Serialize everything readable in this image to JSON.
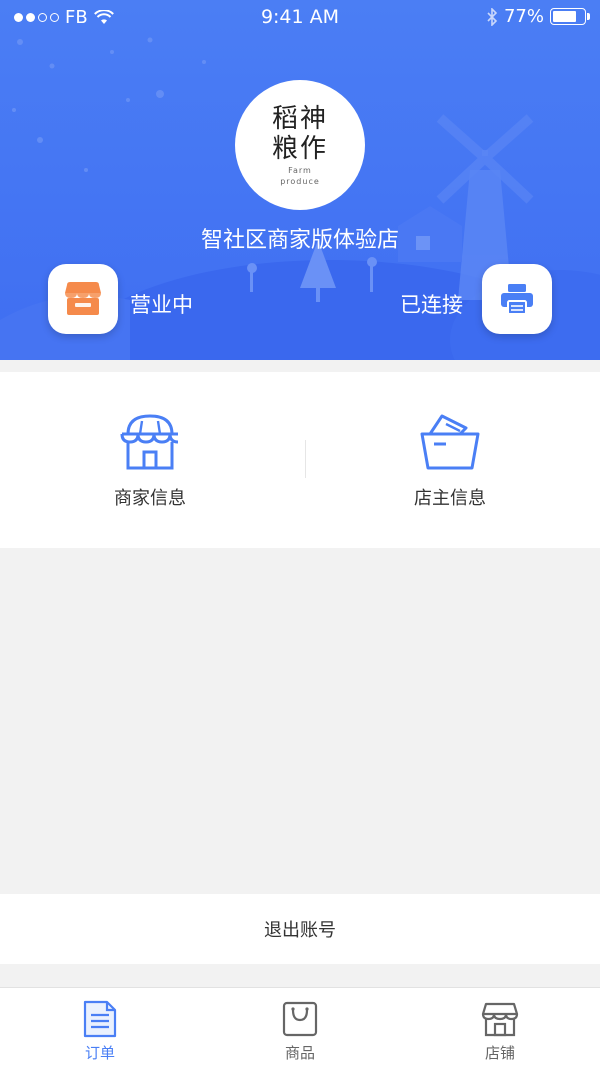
{
  "status_bar": {
    "carrier": "FB",
    "time": "9:41 AM",
    "battery_percent": "77%",
    "battery_level": 0.77
  },
  "header": {
    "logo_line1": "稻神",
    "logo_line2": "粮作",
    "logo_sub1": "Farm",
    "logo_sub2": "produce",
    "store_name": "智社区商家版体验店",
    "business_status_label": "营业中",
    "printer_status_label": "已连接",
    "hero_color": "#4378f3"
  },
  "info": {
    "merchant_label": "商家信息",
    "owner_label": "店主信息"
  },
  "actions": {
    "logout_label": "退出账号"
  },
  "tabbar": {
    "items": [
      {
        "label": "订单",
        "icon": "order-doc-icon",
        "active": true
      },
      {
        "label": "商品",
        "icon": "shopping-bag-icon",
        "active": false
      },
      {
        "label": "店铺",
        "icon": "store-icon",
        "active": false
      }
    ],
    "active_color": "#4a7ff5"
  }
}
